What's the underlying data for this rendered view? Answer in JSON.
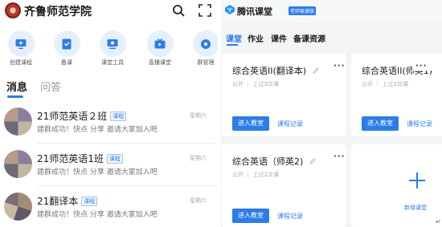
{
  "left": {
    "school_name": "齐鲁师范学院",
    "top_icons": [
      "search-icon",
      "expand-icon"
    ],
    "apps": [
      {
        "label": "创建课程",
        "icon": "create-course-icon"
      },
      {
        "label": "备课",
        "icon": "prepare-lesson-icon"
      },
      {
        "label": "课堂工具",
        "icon": "classroom-tools-icon"
      },
      {
        "label": "直播课堂",
        "icon": "live-class-icon"
      },
      {
        "label": "群管理",
        "icon": "group-manage-icon"
      }
    ],
    "tabs": [
      {
        "label": "消息",
        "active": true
      },
      {
        "label": "问答",
        "active": false
      }
    ],
    "messages": [
      {
        "title": "21师范英语２班",
        "badge": "课程",
        "subtitle": "建群成功！快点 分享 邀请大家加入吧",
        "time": "星期六"
      },
      {
        "title": "21师范英语1班",
        "badge": "课程",
        "subtitle": "建群成功！快点 分享 邀请大家加入吧",
        "time": "星期六"
      },
      {
        "title": "21翻译本",
        "badge": "课程",
        "subtitle": "建群成功！快点 分享 邀请大家加入吧",
        "time": "星期六"
      }
    ]
  },
  "right": {
    "app_name": "腾讯课堂",
    "edition_badge": "老师极速版",
    "nav": [
      {
        "label": "课堂",
        "active": true
      },
      {
        "label": "作业",
        "active": false
      },
      {
        "label": "课件",
        "active": false
      },
      {
        "label": "备课资源",
        "active": false
      }
    ],
    "cards": [
      {
        "title": "综合英语II(翻译本)",
        "meta": "公开 ｜ 上过3次课",
        "enter_label": "进入教室",
        "record_label": "课程记录"
      },
      {
        "title": "综合英语II(师英1)",
        "meta": "公开 ｜ 上过2次课",
        "enter_label": "进入教室",
        "record_label": "课程记录"
      },
      {
        "title": "综合英语（师英2)",
        "meta": "公开 ｜ 上过2次课",
        "enter_label": "进入教室",
        "record_label": "课程记录"
      }
    ],
    "new_card_label": "新增课堂",
    "colors": {
      "accent": "#2b7de9",
      "background": "#f3f4f6"
    }
  },
  "corner_mark": "↵"
}
